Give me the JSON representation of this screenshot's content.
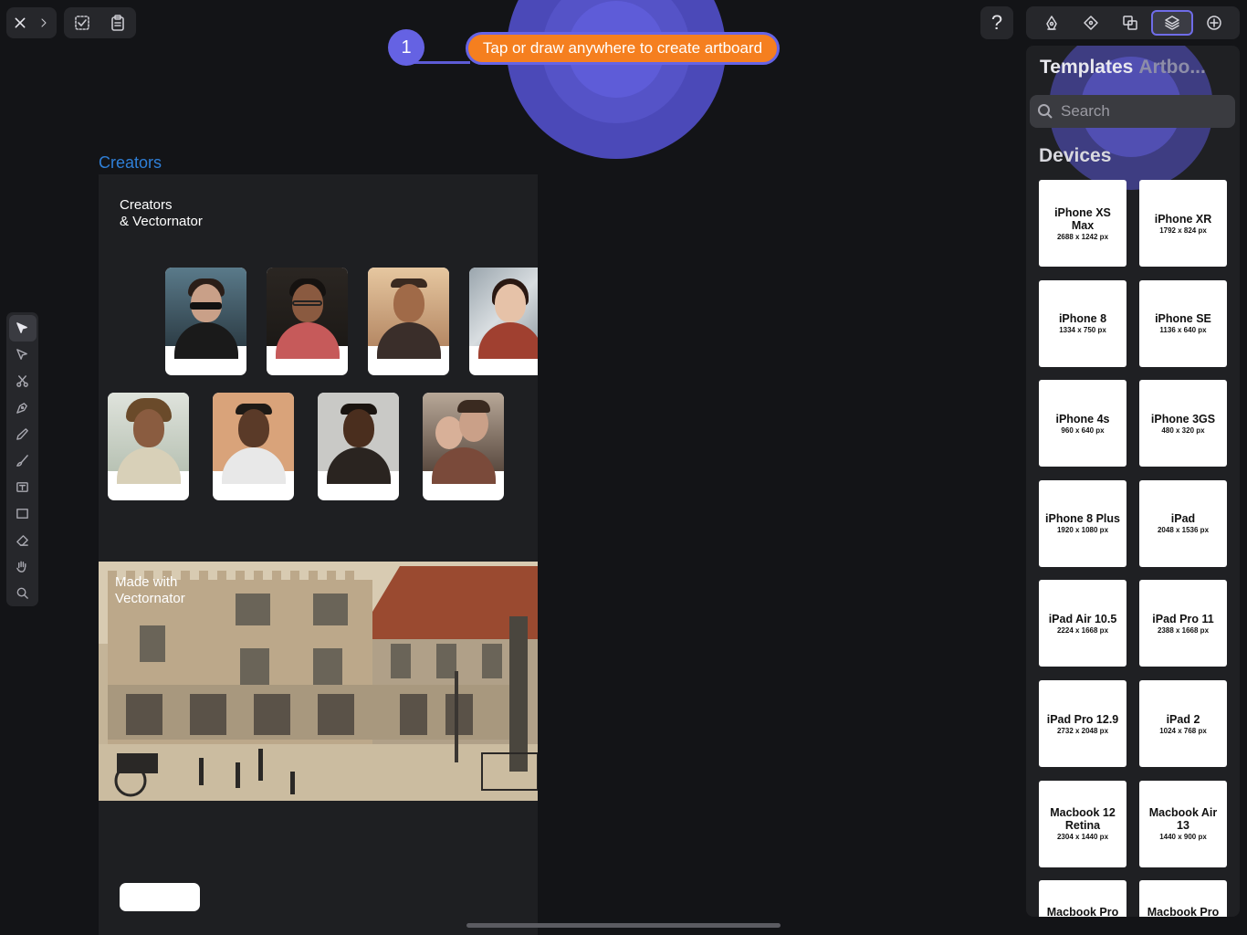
{
  "top_toolbar": {
    "close_icon": "close-icon",
    "forward_icon": "chevron-right-icon",
    "select_icon": "checkbox-select-icon",
    "paste_icon": "clipboard-icon",
    "help_label": "?"
  },
  "right_toolbar": {
    "items": [
      {
        "icon": "style-pen-icon",
        "active": false
      },
      {
        "icon": "path-diamond-icon",
        "active": false
      },
      {
        "icon": "arrange-shapes-icon",
        "active": false
      },
      {
        "icon": "layers-icon",
        "active": true
      },
      {
        "icon": "add-circle-icon",
        "active": false
      }
    ]
  },
  "onboarding": {
    "step_number": "1",
    "hint_text": "Tap or draw anywhere to create artboard",
    "accent_color": "#6664e6",
    "pill_color": "#f57f1f"
  },
  "left_toolbar": {
    "tools": [
      "selection",
      "direct-selection",
      "scissors",
      "pen",
      "pencil",
      "brush",
      "text",
      "rectangle",
      "eraser",
      "hand",
      "zoom"
    ],
    "active_tool": "selection"
  },
  "artboard": {
    "label": "Creators",
    "title": "Creators\n& Vectornator",
    "banner_title": "Made with\nVectornator",
    "label_color": "#2f7fd7"
  },
  "panel": {
    "tab_templates": "Templates",
    "tab_artboards": "Artbo...",
    "search_placeholder": "Search",
    "section_title": "Devices",
    "devices": [
      {
        "name": "iPhone XS Max",
        "dims": "2688 x 1242 px"
      },
      {
        "name": "iPhone XR",
        "dims": "1792 x 824 px"
      },
      {
        "name": "iPhone 8",
        "dims": "1334 x 750 px"
      },
      {
        "name": "iPhone SE",
        "dims": "1136 x 640 px"
      },
      {
        "name": "iPhone 4s",
        "dims": "960 x 640 px"
      },
      {
        "name": "iPhone 3GS",
        "dims": "480 x 320 px"
      },
      {
        "name": "iPhone 8 Plus",
        "dims": "1920 x 1080 px"
      },
      {
        "name": "iPad",
        "dims": "2048 x 1536 px"
      },
      {
        "name": "iPad Air 10.5",
        "dims": "2224 x 1668 px"
      },
      {
        "name": "iPad Pro 11",
        "dims": "2388 x 1668 px"
      },
      {
        "name": "iPad Pro 12.9",
        "dims": "2732 x 2048 px"
      },
      {
        "name": "iPad 2",
        "dims": "1024 x 768 px"
      },
      {
        "name": "Macbook 12 Retina",
        "dims": "2304 x 1440 px"
      },
      {
        "name": "Macbook Air 13",
        "dims": "1440 x 900 px"
      },
      {
        "name": "Macbook Pro",
        "dims": ""
      },
      {
        "name": "Macbook Pro",
        "dims": ""
      }
    ]
  }
}
